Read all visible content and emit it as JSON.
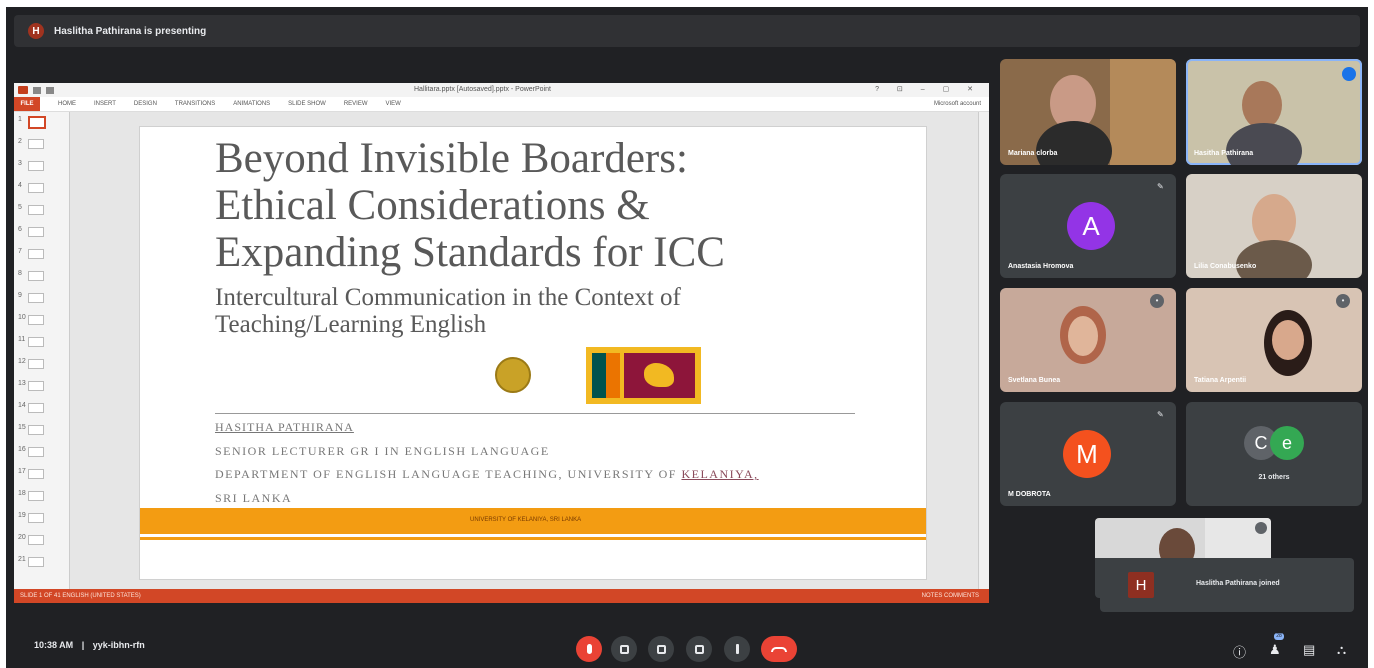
{
  "window_title": "Haslitha Pathirana is presenting",
  "presenter_initial": "H",
  "powerpoint": {
    "file_name": "Hallitara.pptx [Autosaved].pptx - PowerPoint",
    "file_tab": "FILE",
    "tabs": [
      "HOME",
      "INSERT",
      "DESIGN",
      "TRANSITIONS",
      "ANIMATIONS",
      "SLIDE SHOW",
      "REVIEW",
      "VIEW"
    ],
    "account": "Microsoft account",
    "slide_numbers": [
      "1",
      "2",
      "3",
      "4",
      "5",
      "6",
      "7",
      "8",
      "9",
      "10",
      "11",
      "12",
      "13",
      "14",
      "15",
      "16",
      "17",
      "18",
      "19",
      "20",
      "21"
    ],
    "status_left": "SLIDE 1 OF 41    ENGLISH (UNITED STATES)",
    "status_right": "NOTES    COMMENTS"
  },
  "slide": {
    "title_lines": [
      "Beyond Invisible Boarders:",
      "Ethical Considerations &",
      "Expanding Standards for ICC"
    ],
    "subtitle_lines": [
      "Intercultural Communication in the Context of",
      "Teaching/Learning English"
    ],
    "presenter_name": "HASITHA PATHIRANA",
    "role": "SENIOR LECTURER GR I IN ENGLISH LANGUAGE",
    "department_prefix": "DEPARTMENT OF ENGLISH LANGUAGE TEACHING, UNIVERSITY OF ",
    "department_link": "KELANIYA,",
    "country": "SRI LANKA",
    "band_text": "UNIVERSITY OF KELANIYA, SRI LANKA"
  },
  "participants": [
    {
      "name": "Mariana clorba"
    },
    {
      "name": "Hasitha Pathirana"
    },
    {
      "name": "Anastasia Hromova",
      "initial": "A",
      "color": "#9334e6"
    },
    {
      "name": "Lilia Conabusenko"
    },
    {
      "name": "Svetlana Bunea"
    },
    {
      "name": "Tatiana Arpentii"
    },
    {
      "name": "M DOBROTA",
      "initial": "M",
      "color": "#f4511e"
    }
  ],
  "others": {
    "initials": [
      "C",
      "e"
    ],
    "colors": [
      "#5f6368",
      "#34a853"
    ],
    "label": "21 others"
  },
  "toast": {
    "initial": "H",
    "text": "Haslitha Pathirana joined"
  },
  "meeting": {
    "time": "10:38 AM",
    "separator": "|",
    "code": "yyk-ibhn-rfn"
  },
  "people_count": "28",
  "colors": {
    "meet_bg": "#202124",
    "tile_bg": "#3c4043",
    "ppt_orange": "#d24726",
    "end_red": "#ea4335"
  }
}
